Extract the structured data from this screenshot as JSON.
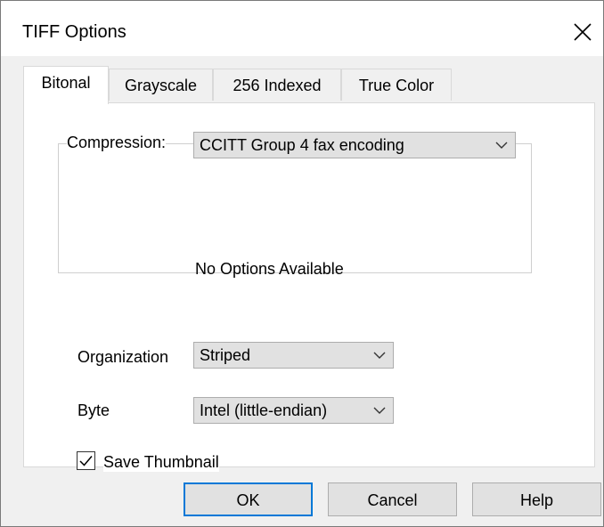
{
  "window": {
    "title": "TIFF Options"
  },
  "icons": {
    "close": "close-icon",
    "dropdown": "chevron-down-icon",
    "check": "checkmark-icon"
  },
  "tabs": [
    {
      "label": "Bitonal",
      "active": true
    },
    {
      "label": "Grayscale",
      "active": false
    },
    {
      "label": "256 Indexed",
      "active": false
    },
    {
      "label": "True Color",
      "active": false
    }
  ],
  "compression": {
    "label": "Compression:",
    "value": "CCITT Group 4 fax encoding"
  },
  "options_message": "No Options Available",
  "organization": {
    "label": "Organization",
    "value": "Striped"
  },
  "byte": {
    "label": "Byte",
    "value": "Intel (little-endian)"
  },
  "thumbnail": {
    "label": "Save Thumbnail",
    "checked": true
  },
  "buttons": {
    "ok": "OK",
    "cancel": "Cancel",
    "help": "Help"
  },
  "colors": {
    "accent": "#0078d7",
    "dialog_bg": "#f0f0f0",
    "button_bg": "#e1e1e1"
  }
}
